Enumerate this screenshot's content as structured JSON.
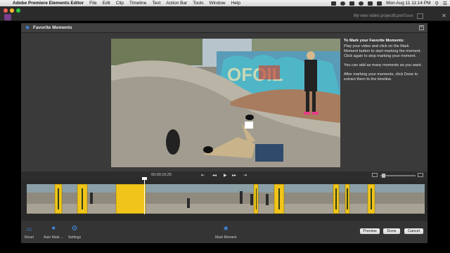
{
  "menubar": {
    "app_name": "Adobe Premiere Elements Editor",
    "items": [
      "File",
      "Edit",
      "Clip",
      "Timeline",
      "Text",
      "Action Bar",
      "Tools",
      "Window",
      "Help"
    ],
    "clock": "Mon Aug 11  11:14 PM"
  },
  "titlebar": {
    "project_name": "My new video project8.prel",
    "save_label": "Save"
  },
  "dialog": {
    "title": "Favorite Moments",
    "instructions": {
      "heading": "To Mark your Favorite Moments:",
      "paragraph1": "Play your video and click on the Mark Moment button to start marking the moment. Click again to stop marking your moment.",
      "paragraph2": "You can add as many moments as you want.",
      "paragraph3": "After marking your moments, click Done to extract them to the timeline."
    },
    "timecode": "00;00;16;25"
  },
  "toolbar": {
    "reset_label": "Reset",
    "auto_mark_label": "Auto Mark ...",
    "settings_label": "Settings",
    "mark_moment_label": "Mark Moment",
    "preview_label": "Preview",
    "done_label": "Done",
    "cancel_label": "Cancel"
  },
  "colors": {
    "accent": "#3d8ee6",
    "moment_highlight": "#f0c419",
    "app_icon": "#7a3f8f"
  }
}
